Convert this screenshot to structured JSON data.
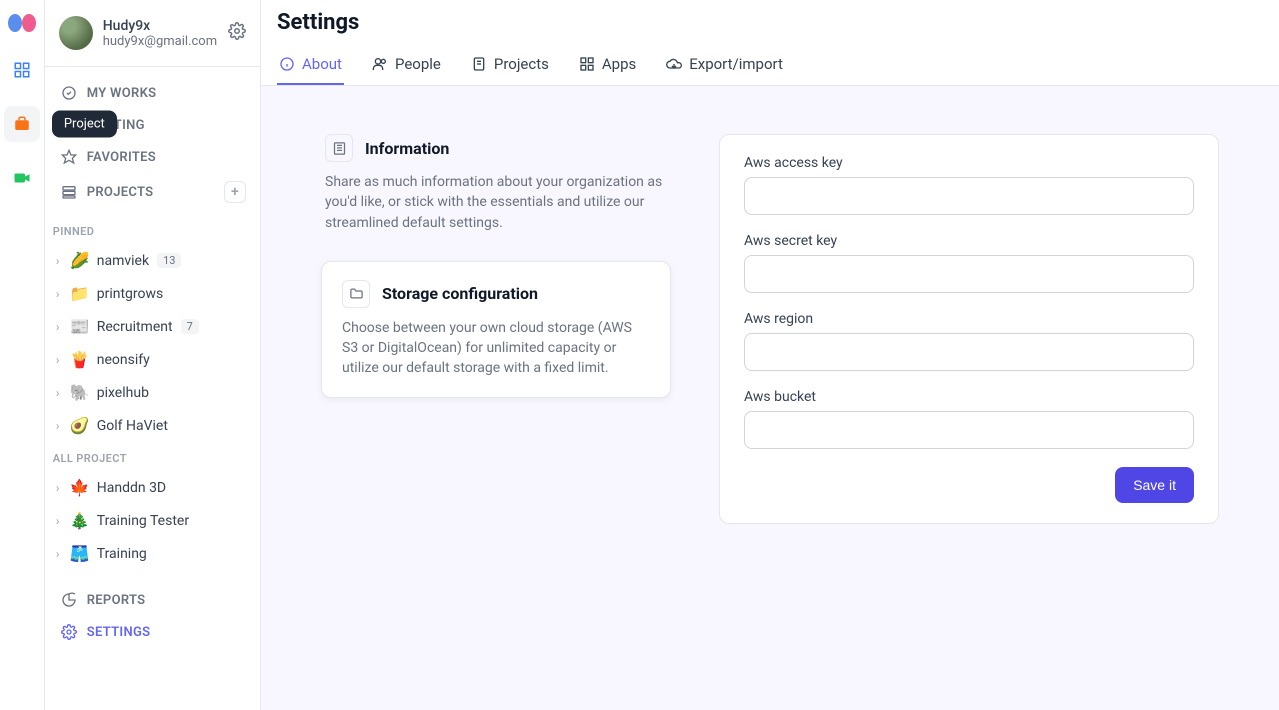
{
  "tooltip": {
    "project": "Project"
  },
  "user": {
    "name": "Hudy9x",
    "email": "hudy9x@gmail.com"
  },
  "nav": {
    "works": "MY WORKS",
    "meeting": "MEETING",
    "favorites": "FAVORITES",
    "projects": "PROJECTS",
    "reports": "REPORTS",
    "settings": "SETTINGS"
  },
  "sections": {
    "pinned": "PINNED",
    "all": "ALL PROJECT"
  },
  "pinned": [
    {
      "emoji": "🌽",
      "name": "namviek",
      "badge": "13"
    },
    {
      "emoji": "📁",
      "name": "printgrows"
    },
    {
      "emoji": "📰",
      "name": "Recruitment",
      "badge": "7"
    },
    {
      "emoji": "🍟",
      "name": "neonsify"
    },
    {
      "emoji": "🐘",
      "name": "pixelhub"
    },
    {
      "emoji": "🥑",
      "name": "Golf HaViet"
    }
  ],
  "all": [
    {
      "emoji": "🍁",
      "name": "Handdn 3D"
    },
    {
      "emoji": "🎄",
      "name": "Training Tester"
    },
    {
      "emoji": "🩳",
      "name": "Training"
    }
  ],
  "page": {
    "title": "Settings"
  },
  "tabs": {
    "about": "About",
    "people": "People",
    "projects": "Projects",
    "apps": "Apps",
    "export": "Export/import"
  },
  "cards": {
    "info": {
      "title": "Information",
      "desc": "Share as much information about your organization as you'd like, or stick with the essentials and utilize our streamlined default settings."
    },
    "storage": {
      "title": "Storage configuration",
      "desc": "Choose between your own cloud storage (AWS S3 or DigitalOcean) for unlimited capacity or utilize our default storage with a fixed limit."
    }
  },
  "form": {
    "access": "Aws access key",
    "secret": "Aws secret key",
    "region": "Aws region",
    "bucket": "Aws bucket",
    "save": "Save it"
  }
}
